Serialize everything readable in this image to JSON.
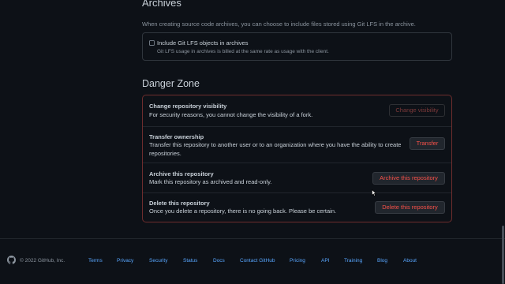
{
  "archives": {
    "title": "Archives",
    "description": "When creating source code archives, you can choose to include files stored using Git LFS in the archive.",
    "lfs_option": {
      "label": "Include Git LFS objects in archives",
      "note": "Git LFS usage in archives is billed at the same rate as usage with the client.",
      "checked": false
    }
  },
  "danger_zone": {
    "title": "Danger Zone",
    "rows": [
      {
        "title": "Change repository visibility",
        "description": "For security reasons, you cannot change the visibility of a fork.",
        "button": "Change visibility",
        "button_disabled": true
      },
      {
        "title": "Transfer ownership",
        "description": "Transfer this repository to another user or to an organization where you have the ability to create repositories.",
        "button": "Transfer",
        "button_disabled": false
      },
      {
        "title": "Archive this repository",
        "description": "Mark this repository as archived and read-only.",
        "button": "Archive this repository",
        "button_disabled": false
      },
      {
        "title": "Delete this repository",
        "description": "Once you delete a repository, there is no going back. Please be certain.",
        "button": "Delete this repository",
        "button_disabled": false
      }
    ]
  },
  "footer": {
    "copyright": "© 2022 GitHub, Inc.",
    "links": [
      "Terms",
      "Privacy",
      "Security",
      "Status",
      "Docs",
      "Contact GitHub",
      "Pricing",
      "API",
      "Training",
      "Blog",
      "About"
    ],
    "logo_icon": "github-mark-icon"
  },
  "colors": {
    "background": "#0d1117",
    "danger": "#f85149",
    "link": "#58a6ff",
    "danger_border": "#6e2d2d"
  }
}
